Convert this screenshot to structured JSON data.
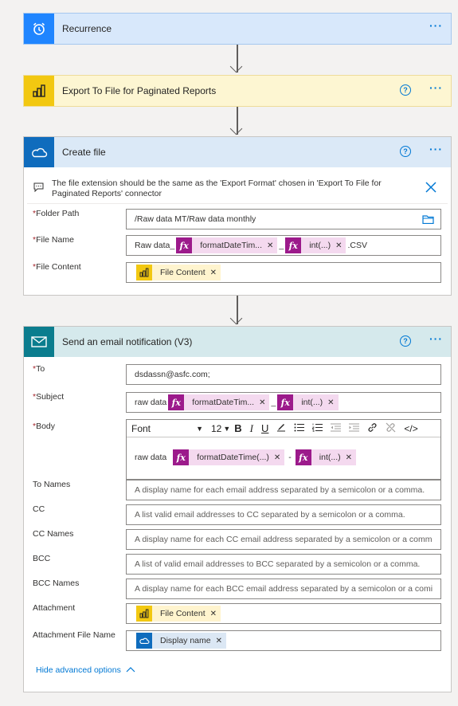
{
  "recurrence": {
    "title": "Recurrence",
    "more": "···"
  },
  "export": {
    "title": "Export To File for Paginated Reports",
    "help": "?",
    "more": "···"
  },
  "create_file": {
    "title": "Create file",
    "help": "?",
    "more": "···",
    "notice": "The file extension should be the same as the 'Export Format' chosen in 'Export To File for Paginated Reports' connector",
    "folder_label": "Folder Path",
    "folder_value": "/Raw data MT/Raw data monthly",
    "filename_label": "File Name",
    "filename_prefix": "Raw data_",
    "filename_token1": "formatDateTim...",
    "filename_sep": "_",
    "filename_token2": "int(...)",
    "filename_suffix": ".CSV",
    "content_label": "File Content",
    "content_token": "File Content"
  },
  "email": {
    "title": "Send an email notification (V3)",
    "help": "?",
    "more": "···",
    "to_label": "To",
    "to_value": "dsdassn@asfc.com;",
    "subject_label": "Subject",
    "subject_prefix": "raw data",
    "subject_token1": "formatDateTim...",
    "subject_sep": "_",
    "subject_token2": "int(...)",
    "body_label": "Body",
    "font": "Font",
    "font_size": "12",
    "body_prefix": "raw data",
    "body_token1": "formatDateTime(...)",
    "body_sep": "-",
    "body_token2": "int(...)",
    "tonames_label": "To Names",
    "tonames_ph": "A display name for each email address separated by a semicolon or a comma.",
    "cc_label": "CC",
    "cc_ph": "A list valid email addresses to CC separated by a semicolon or a comma.",
    "ccnames_label": "CC Names",
    "ccnames_ph": "A display name for each CC email address separated by a semicolon or a comm",
    "bcc_label": "BCC",
    "bcc_ph": "A list of valid email addresses to BCC separated by a semicolon or a comma.",
    "bccnames_label": "BCC Names",
    "bccnames_ph": "A display name for each BCC email address separated by a semicolon or a comi",
    "attachment_label": "Attachment",
    "attachment_token": "File Content",
    "attachname_label": "Attachment File Name",
    "attachname_token": "Display name",
    "hide_advanced": "Hide advanced options"
  },
  "colors": {
    "accent": "#0078d4",
    "token": "#9c1a8b",
    "required": "#a4262c"
  }
}
